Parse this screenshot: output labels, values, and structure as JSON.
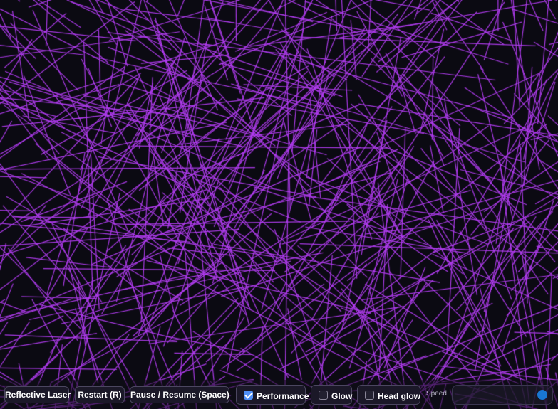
{
  "canvas": {
    "background": "#0b0a12",
    "line_color": "#b13cf0"
  },
  "toolbar": {
    "title_button": "Reflective Laser",
    "restart_button": "Restart (R)",
    "pause_button": "Pause / Resume (Space)",
    "performance": {
      "label": "Performance",
      "checked": true
    },
    "glow": {
      "label": "Glow",
      "checked": false
    },
    "head_glow": {
      "label": "Head glow",
      "checked": false
    },
    "speed_label": "Speed",
    "speed_value": 0.95,
    "accent_color": "#4f8ff7",
    "slider_color": "#1976d2"
  }
}
